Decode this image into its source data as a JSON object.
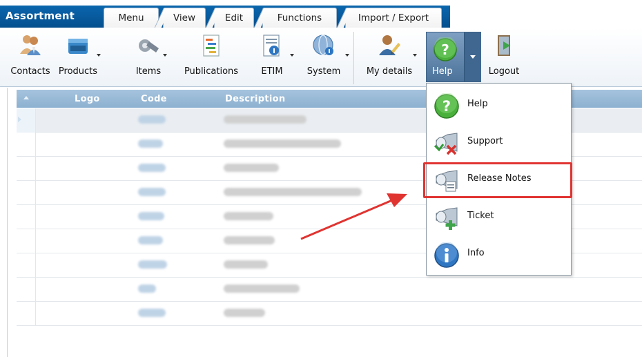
{
  "app": {
    "title": "Assortment"
  },
  "tabs": [
    "Menu",
    "View",
    "Edit",
    "Functions",
    "Import / Export"
  ],
  "toolbar": {
    "contacts": "Contacts",
    "products": "Products",
    "items": "Items",
    "publications": "Publications",
    "etim": "ETIM",
    "system": "System",
    "my_details": "My details",
    "help": "Help",
    "logout": "Logout"
  },
  "grid": {
    "columns": [
      "Logo",
      "Code",
      "Description"
    ],
    "row_count": 9
  },
  "help_menu": {
    "items": [
      "Help",
      "Support",
      "Release Notes",
      "Ticket",
      "Info"
    ],
    "highlighted": "Release Notes"
  },
  "colors": {
    "brand_blue": "#0b66ad",
    "header_blue": "#99bbd8",
    "highlight_red": "#e03431"
  }
}
